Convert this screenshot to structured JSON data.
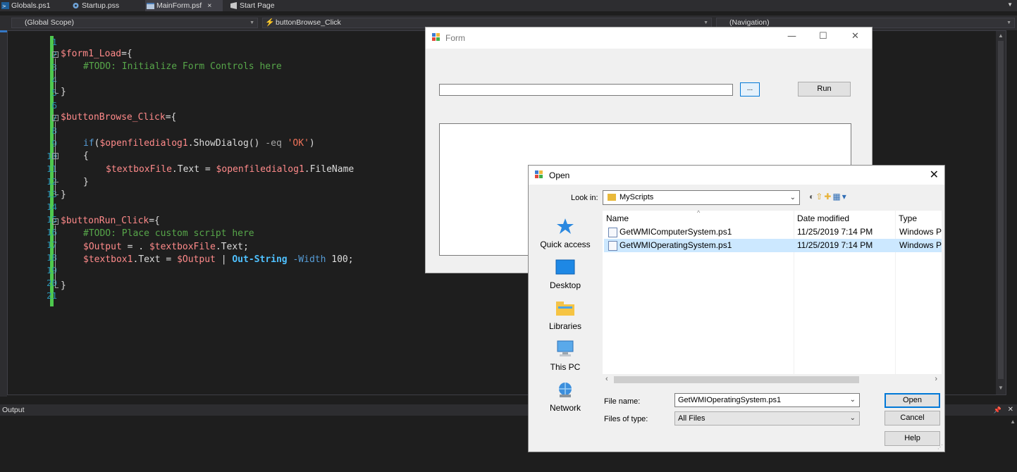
{
  "ide": {
    "tabs": [
      {
        "label": "Globals.ps1",
        "active": false
      },
      {
        "label": "Startup.pss",
        "active": false
      },
      {
        "label": "MainForm.psf",
        "active": true,
        "close": "×"
      },
      {
        "label": "Start Page",
        "active": false
      }
    ],
    "scope_combo": "(Global Scope)",
    "member_combo": "buttonBrowse_Click",
    "nav_combo": "(Navigation)",
    "output_title": "Output"
  },
  "code_lines": [
    "1",
    "2",
    "3",
    "4",
    "5",
    "6",
    "7",
    "8",
    "9",
    "10",
    "11",
    "12",
    "13",
    "14",
    "15",
    "16",
    "17",
    "18",
    "19",
    "20",
    "21"
  ],
  "code": {
    "l2": {
      "var": "$form1_Load",
      "rest": "={"
    },
    "l3": "#TODO: Initialize Form Controls here",
    "l5": "}",
    "l7": {
      "var": "$buttonBrowse_Click",
      "rest": "={"
    },
    "l9": {
      "kw": "if",
      "p1": "(",
      "var": "$openfiledialog1",
      "m": ".ShowDialog() ",
      "op": "-eq",
      "sp": " ",
      "str": "'OK'",
      "p2": ")"
    },
    "l10": "{",
    "l11": {
      "var1": "$textboxFile",
      "m1": ".Text = ",
      "var2": "$openfiledialog1",
      "m2": ".FileName"
    },
    "l12": "}",
    "l13": "}",
    "l15": {
      "var": "$buttonRun_Click",
      "rest": "={"
    },
    "l16": "#TODO: Place custom script here",
    "l17": {
      "var1": "$Output",
      "m1": " = . ",
      "var2": "$textboxFile",
      "m2": ".Text;"
    },
    "l18": {
      "var1": "$textbox1",
      "m1": ".Text = ",
      "var2": "$Output",
      "m2": " | ",
      "cmd": "Out-String",
      "sp": " ",
      "param": "-Width",
      "num": " 100;"
    },
    "l20": "}"
  },
  "form": {
    "title": "Form",
    "browse_label": "...",
    "run_label": "Run"
  },
  "dialog": {
    "title": "Open",
    "look_in_label": "Look in:",
    "look_in_value": "MyScripts",
    "places": [
      "Quick access",
      "Desktop",
      "Libraries",
      "This PC",
      "Network"
    ],
    "columns": [
      "Name",
      "Date modified",
      "Type"
    ],
    "files": [
      {
        "name": "GetWMIComputerSystem.ps1",
        "date": "11/25/2019 7:14 PM",
        "type": "Windows P",
        "selected": false
      },
      {
        "name": "GetWMIOperatingSystem.ps1",
        "date": "11/25/2019 7:14 PM",
        "type": "Windows P",
        "selected": true
      }
    ],
    "file_name_label": "File name:",
    "file_name_value": "GetWMIOperatingSystem.ps1",
    "file_type_label": "Files of type:",
    "file_type_value": "All Files",
    "open_label": "Open",
    "cancel_label": "Cancel",
    "help_label": "Help"
  },
  "colors": {
    "accent": "#0078d7",
    "change_bar": "#4ec84e",
    "line_numbers": "#2b91af",
    "variable": "#ff8a8a",
    "comment": "#57a64a",
    "keyword": "#569cd6",
    "string": "#f0735a"
  }
}
